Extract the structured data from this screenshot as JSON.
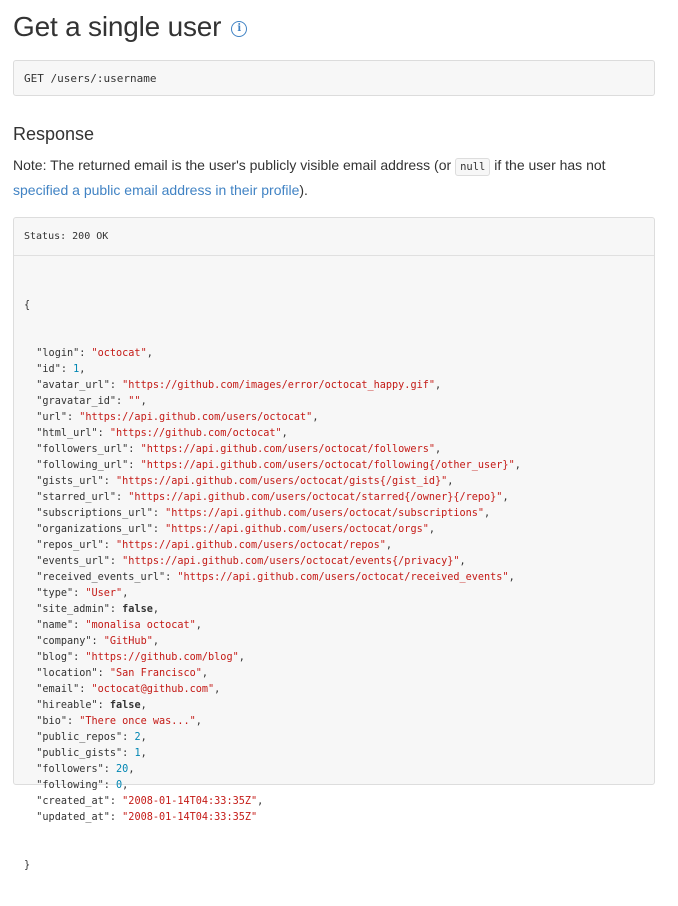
{
  "header": {
    "title": "Get a single user",
    "info_icon": "info-icon"
  },
  "endpoint": {
    "text": "GET /users/:username"
  },
  "response": {
    "heading": "Response",
    "note": {
      "prefix": "Note: The returned email is the user's publicly visible email address (or ",
      "code": "null",
      "middle": " if the user has not ",
      "link": "specified a public email address in their profile",
      "suffix": ")."
    },
    "status": "Status: 200 OK",
    "open_brace": "{",
    "close_brace": "}",
    "fields": [
      {
        "key": "login",
        "value": "\"octocat\"",
        "type": "str",
        "comma": ","
      },
      {
        "key": "id",
        "value": "1",
        "type": "num",
        "comma": ","
      },
      {
        "key": "avatar_url",
        "value": "\"https://github.com/images/error/octocat_happy.gif\"",
        "type": "str",
        "comma": ","
      },
      {
        "key": "gravatar_id",
        "value": "\"\"",
        "type": "str",
        "comma": ","
      },
      {
        "key": "url",
        "value": "\"https://api.github.com/users/octocat\"",
        "type": "str",
        "comma": ","
      },
      {
        "key": "html_url",
        "value": "\"https://github.com/octocat\"",
        "type": "str",
        "comma": ","
      },
      {
        "key": "followers_url",
        "value": "\"https://api.github.com/users/octocat/followers\"",
        "type": "str",
        "comma": ","
      },
      {
        "key": "following_url",
        "value": "\"https://api.github.com/users/octocat/following{/other_user}\"",
        "type": "str",
        "comma": ","
      },
      {
        "key": "gists_url",
        "value": "\"https://api.github.com/users/octocat/gists{/gist_id}\"",
        "type": "str",
        "comma": ","
      },
      {
        "key": "starred_url",
        "value": "\"https://api.github.com/users/octocat/starred{/owner}{/repo}\"",
        "type": "str",
        "comma": ","
      },
      {
        "key": "subscriptions_url",
        "value": "\"https://api.github.com/users/octocat/subscriptions\"",
        "type": "str",
        "comma": ","
      },
      {
        "key": "organizations_url",
        "value": "\"https://api.github.com/users/octocat/orgs\"",
        "type": "str",
        "comma": ","
      },
      {
        "key": "repos_url",
        "value": "\"https://api.github.com/users/octocat/repos\"",
        "type": "str",
        "comma": ","
      },
      {
        "key": "events_url",
        "value": "\"https://api.github.com/users/octocat/events{/privacy}\"",
        "type": "str",
        "comma": ","
      },
      {
        "key": "received_events_url",
        "value": "\"https://api.github.com/users/octocat/received_events\"",
        "type": "str",
        "comma": ","
      },
      {
        "key": "type",
        "value": "\"User\"",
        "type": "str",
        "comma": ","
      },
      {
        "key": "site_admin",
        "value": "false",
        "type": "bool",
        "comma": ","
      },
      {
        "key": "name",
        "value": "\"monalisa octocat\"",
        "type": "str",
        "comma": ","
      },
      {
        "key": "company",
        "value": "\"GitHub\"",
        "type": "str",
        "comma": ","
      },
      {
        "key": "blog",
        "value": "\"https://github.com/blog\"",
        "type": "str",
        "comma": ","
      },
      {
        "key": "location",
        "value": "\"San Francisco\"",
        "type": "str",
        "comma": ","
      },
      {
        "key": "email",
        "value": "\"octocat@github.com\"",
        "type": "str",
        "comma": ","
      },
      {
        "key": "hireable",
        "value": "false",
        "type": "bool",
        "comma": ","
      },
      {
        "key": "bio",
        "value": "\"There once was...\"",
        "type": "str",
        "comma": ","
      },
      {
        "key": "public_repos",
        "value": "2",
        "type": "num",
        "comma": ","
      },
      {
        "key": "public_gists",
        "value": "1",
        "type": "num",
        "comma": ","
      },
      {
        "key": "followers",
        "value": "20",
        "type": "num",
        "comma": ","
      },
      {
        "key": "following",
        "value": "0",
        "type": "num",
        "comma": ","
      },
      {
        "key": "created_at",
        "value": "\"2008-01-14T04:33:35Z\"",
        "type": "str",
        "comma": ","
      },
      {
        "key": "updated_at",
        "value": "\"2008-01-14T04:33:35Z\"",
        "type": "str",
        "comma": ""
      }
    ]
  },
  "colors": {
    "link": "#4183c4",
    "string": "#c41a16",
    "number": "#0086b3",
    "code_bg": "#f7f7f7",
    "border": "#dddddd"
  }
}
